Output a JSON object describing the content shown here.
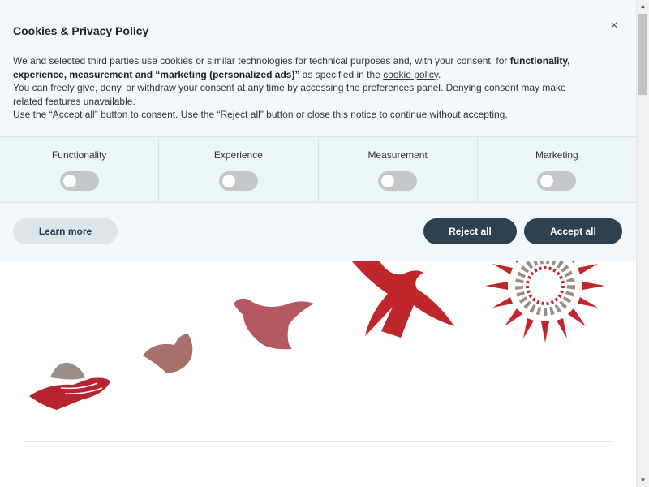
{
  "banner": {
    "title": "Cookies & Privacy Policy",
    "close_icon": "×",
    "text": {
      "p1_pre": "We and selected third parties use cookies or similar technologies for technical purposes and, with your consent, for ",
      "p1_bold": "functionality, experience, measurement and “marketing (personalized ads)”",
      "p1_mid": " as specified in the ",
      "p1_link": "cookie policy",
      "p1_post": ".",
      "p2": "You can freely give, deny, or withdraw your consent at any time by accessing the preferences panel. Denying consent may make related features unavailable.",
      "p3": "Use the “Accept all” button to consent. Use the “Reject all” button or close this notice to continue without accepting."
    },
    "categories": [
      {
        "label": "Functionality",
        "enabled": false
      },
      {
        "label": "Experience",
        "enabled": false
      },
      {
        "label": "Measurement",
        "enabled": false
      },
      {
        "label": "Marketing",
        "enabled": false
      }
    ],
    "buttons": {
      "learn_more": "Learn more",
      "reject_all": "Reject all",
      "accept_all": "Accept all"
    }
  },
  "colors": {
    "banner_bg": "#f2f8fb",
    "primary_button": "#2d4150",
    "secondary_button": "#dfe4e8",
    "toggle_off": "#c3c7cb",
    "art_red": "#b8232f",
    "art_rose": "#b35a60",
    "art_taupe": "#9a8f86"
  }
}
